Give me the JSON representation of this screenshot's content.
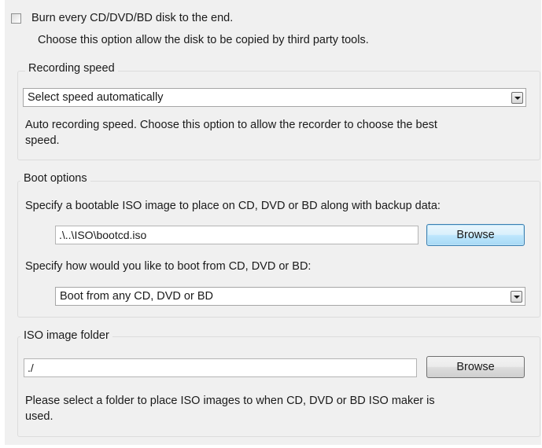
{
  "burn_option": {
    "checked": false,
    "label": "Burn every CD/DVD/BD disk to the end.",
    "description": "Choose this option allow the disk to be copied by third party tools."
  },
  "recording_speed": {
    "title": "Recording speed",
    "selected": "Select speed automatically",
    "description_line1": "Auto recording speed. Choose this option to allow the recorder to choose the best",
    "description_line2": "speed."
  },
  "boot_options": {
    "title": "Boot options",
    "iso_prompt": "Specify a bootable ISO image to place on CD, DVD or BD along with backup data:",
    "iso_path": ".\\..\\ISO\\bootcd.iso",
    "browse_label": "Browse",
    "boot_prompt": "Specify how would you like to boot from CD, DVD or BD:",
    "boot_selected": "Boot from any CD, DVD or BD"
  },
  "iso_folder": {
    "title": "ISO image folder",
    "path": "./",
    "browse_label": "Browse",
    "description_line1": "Please select a folder to place ISO images to when CD, DVD or BD ISO maker is",
    "description_line2": "used."
  }
}
